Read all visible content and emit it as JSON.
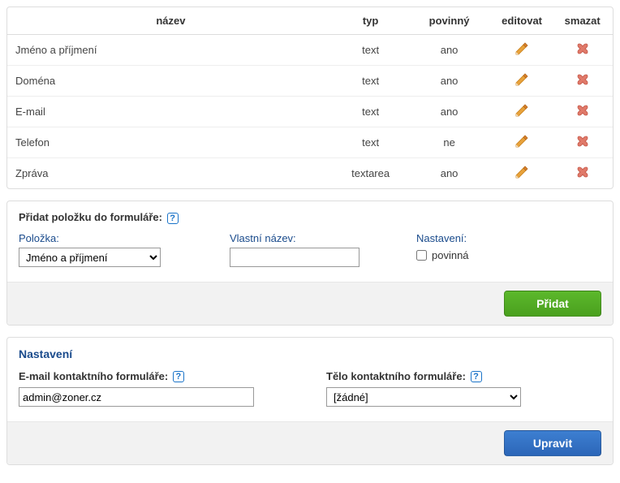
{
  "table": {
    "headers": {
      "name": "název",
      "type": "typ",
      "required": "povinný",
      "edit": "editovat",
      "delete": "smazat"
    },
    "rows": [
      {
        "name": "Jméno a příjmení",
        "type": "text",
        "required": "ano"
      },
      {
        "name": "Doména",
        "type": "text",
        "required": "ano"
      },
      {
        "name": "E-mail",
        "type": "text",
        "required": "ano"
      },
      {
        "name": "Telefon",
        "type": "text",
        "required": "ne"
      },
      {
        "name": "Zpráva",
        "type": "textarea",
        "required": "ano"
      }
    ]
  },
  "add": {
    "title": "Přidat položku do formuláře:",
    "field_label": "Položka:",
    "field_value": "Jméno a příjmení",
    "custom_label": "Vlastní název:",
    "custom_value": "",
    "settings_label": "Nastavení:",
    "required_label": "povinná",
    "button": "Přidat"
  },
  "settings": {
    "title": "Nastavení",
    "email_label": "E-mail kontaktního formuláře:",
    "email_value": "admin@zoner.cz",
    "body_label": "Tělo kontaktního formuláře:",
    "body_value": "[žádné]",
    "button": "Upravit"
  },
  "help_glyph": "?"
}
